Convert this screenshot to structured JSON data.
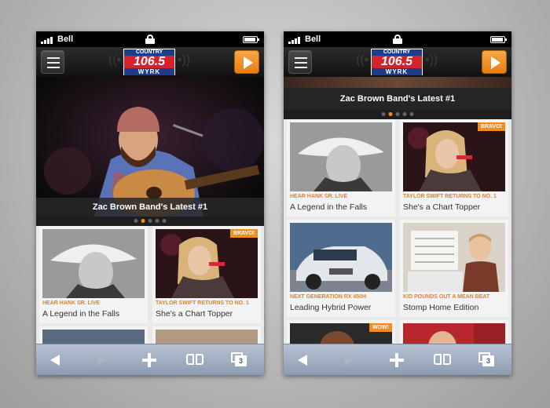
{
  "status_bar": {
    "carrier": "Bell"
  },
  "station_logo": {
    "line1": "COUNTRY",
    "line2": "106.5",
    "line3": "WYRK"
  },
  "hero": {
    "caption": "Zac Brown Band's Latest #1"
  },
  "cards": [
    {
      "kicker": "HEAR HANK SR. LIVE",
      "headline": "A Legend in the Falls",
      "badge": ""
    },
    {
      "kicker": "TAYLOR SWIFT RETURNS TO NO. 1",
      "headline": "She's a Chart Topper",
      "badge": "BRAVO!"
    },
    {
      "kicker": "NEXT GENERATION RX 450H",
      "headline": "Leading Hybrid Power",
      "badge": ""
    },
    {
      "kicker": "KID POUNDS OUT A MEAN BEAT",
      "headline": "Stomp Home Edition",
      "badge": ""
    },
    {
      "kicker": "",
      "headline": "",
      "badge": "WOW!"
    },
    {
      "kicker": "",
      "headline": "",
      "badge": ""
    }
  ],
  "toolbar": {
    "tab_count": "3"
  },
  "colors": {
    "accent": "#f08d1e",
    "logo_blue": "#1f3c8a",
    "logo_red": "#d6232a",
    "toolbar": "#9eabbf"
  },
  "icons": [
    "signal-icon",
    "lock-icon",
    "battery-icon",
    "menu-icon",
    "play-icon",
    "back-arrow-icon",
    "forward-arrow-icon",
    "add-icon",
    "bookmarks-icon",
    "tabs-icon"
  ]
}
